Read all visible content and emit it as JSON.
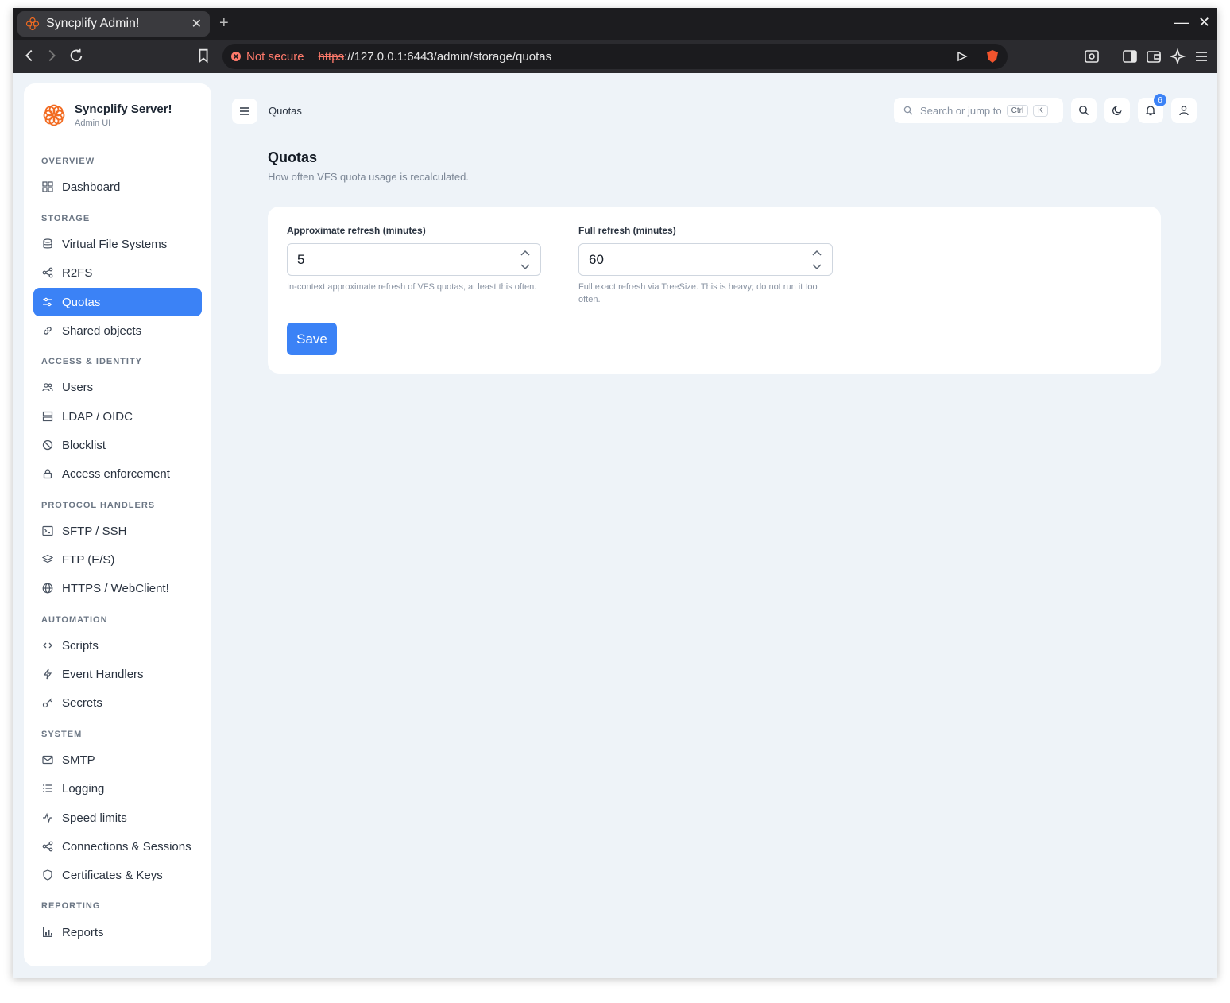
{
  "browser": {
    "tab_title": "Syncplify Admin!",
    "security_label": "Not secure",
    "url_scheme": "https",
    "url_rest": "://127.0.0.1:6443/admin/storage/quotas"
  },
  "brand": {
    "title": "Syncplify Server!",
    "subtitle": "Admin UI",
    "color": "#f26b21"
  },
  "sidebar": {
    "sections": [
      {
        "label": "OVERVIEW",
        "items": [
          {
            "label": "Dashboard",
            "icon": "grid-icon"
          }
        ]
      },
      {
        "label": "STORAGE",
        "items": [
          {
            "label": "Virtual File Systems",
            "icon": "database-icon"
          },
          {
            "label": "R2FS",
            "icon": "share-icon"
          },
          {
            "label": "Quotas",
            "icon": "sliders-icon",
            "active": true
          },
          {
            "label": "Shared objects",
            "icon": "link-icon"
          }
        ]
      },
      {
        "label": "ACCESS & IDENTITY",
        "items": [
          {
            "label": "Users",
            "icon": "users-icon"
          },
          {
            "label": "LDAP / OIDC",
            "icon": "server-icon"
          },
          {
            "label": "Blocklist",
            "icon": "ban-icon"
          },
          {
            "label": "Access enforcement",
            "icon": "lock-icon"
          }
        ]
      },
      {
        "label": "PROTOCOL HANDLERS",
        "items": [
          {
            "label": "SFTP / SSH",
            "icon": "terminal-icon"
          },
          {
            "label": "FTP (E/S)",
            "icon": "layers-icon"
          },
          {
            "label": "HTTPS / WebClient!",
            "icon": "globe-icon"
          }
        ]
      },
      {
        "label": "AUTOMATION",
        "items": [
          {
            "label": "Scripts",
            "icon": "code-icon"
          },
          {
            "label": "Event Handlers",
            "icon": "bolt-icon"
          },
          {
            "label": "Secrets",
            "icon": "key-icon"
          }
        ]
      },
      {
        "label": "SYSTEM",
        "items": [
          {
            "label": "SMTP",
            "icon": "mail-icon"
          },
          {
            "label": "Logging",
            "icon": "list-icon"
          },
          {
            "label": "Speed limits",
            "icon": "activity-icon"
          },
          {
            "label": "Connections & Sessions",
            "icon": "share-icon"
          },
          {
            "label": "Certificates & Keys",
            "icon": "shield-icon"
          }
        ]
      },
      {
        "label": "REPORTING",
        "items": [
          {
            "label": "Reports",
            "icon": "bar-chart-icon"
          }
        ]
      }
    ]
  },
  "topbar": {
    "breadcrumb": "Quotas",
    "search_placeholder": "Search or jump to",
    "kbd_ctrl": "Ctrl",
    "kbd_k": "K",
    "notification_count": "6"
  },
  "page": {
    "title": "Quotas",
    "subtitle": "How often VFS quota usage is recalculated."
  },
  "form": {
    "approx": {
      "label": "Approximate refresh (minutes)",
      "value": "5",
      "help": "In-context approximate refresh of VFS quotas, at least this often."
    },
    "full": {
      "label": "Full refresh (minutes)",
      "value": "60",
      "help": "Full exact refresh via TreeSize. This is heavy; do not run it too often."
    },
    "save_label": "Save"
  },
  "colors": {
    "accent": "#3b82f6",
    "warning": "#ff7a6b"
  }
}
